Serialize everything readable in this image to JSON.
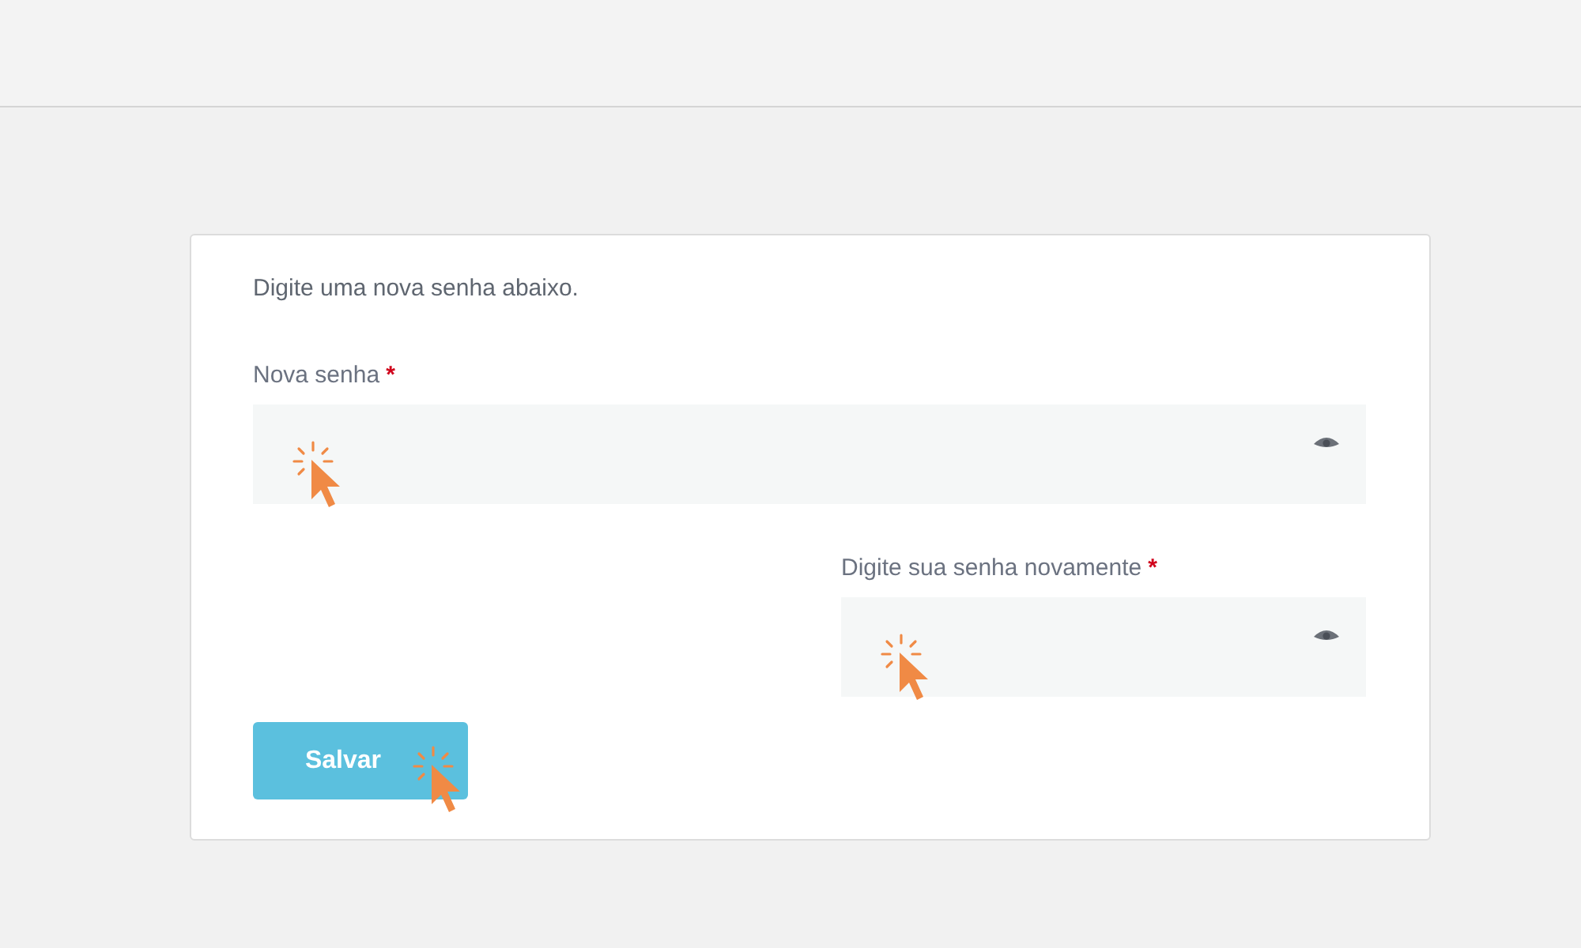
{
  "intro": "Digite uma nova senha abaixo.",
  "fields": [
    {
      "label": "Nova senha",
      "required_mark": "*",
      "kind": "full"
    },
    {
      "label": "Digite sua senha novamente",
      "required_mark": "*",
      "kind": "right"
    }
  ],
  "button": {
    "label": "Salvar"
  }
}
